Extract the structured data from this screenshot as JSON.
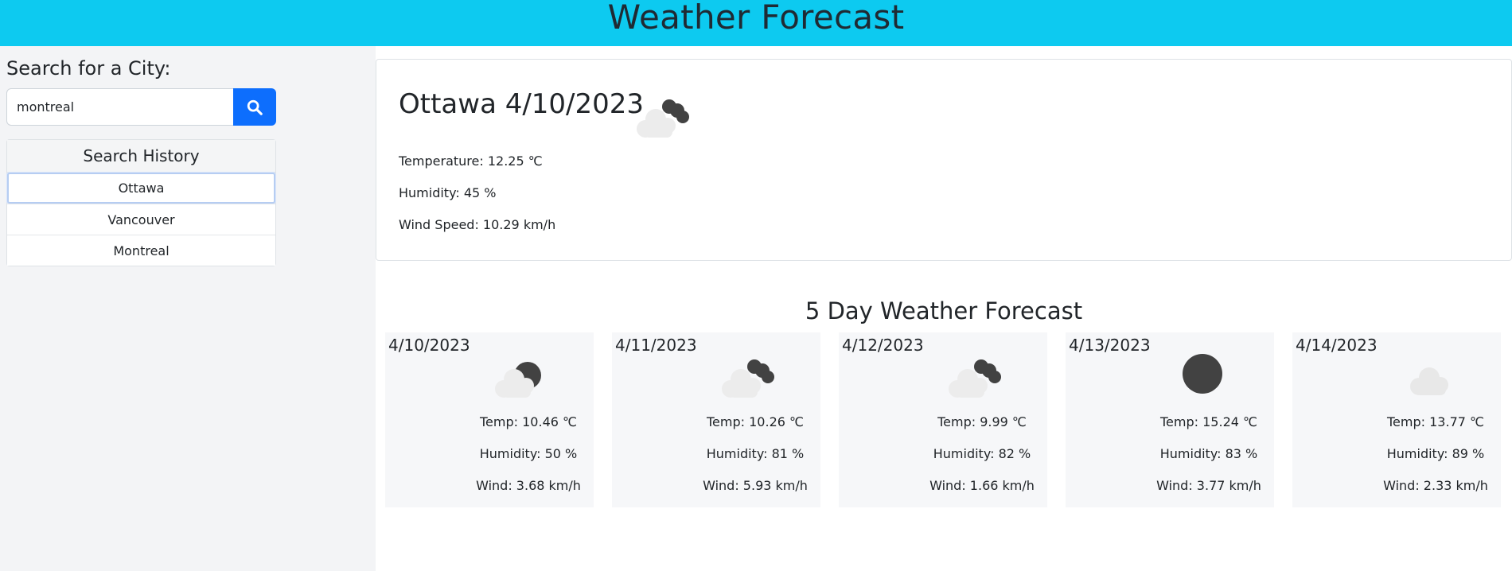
{
  "header": {
    "title": "Weather Forecast"
  },
  "search": {
    "label": "Search for a City:",
    "value": "montreal",
    "button_icon": "search-icon",
    "accent": "#0d6efd"
  },
  "history": {
    "title": "Search History",
    "items": [
      "Ottawa",
      "Vancouver",
      "Montreal"
    ]
  },
  "current": {
    "title": "Ottawa 4/10/2023",
    "icon": "broken-clouds-icon",
    "temperature": "Temperature: 12.25 ℃",
    "humidity": "Humidity: 45 %",
    "wind": "Wind Speed: 10.29 km/h"
  },
  "forecast": {
    "title": "5 Day Weather Forecast",
    "days": [
      {
        "date": "4/10/2023",
        "icon": "partly-cloudy-icon",
        "temp": "Temp: 10.46 ℃",
        "humidity": "Humidity: 50 %",
        "wind": "Wind: 3.68 km/h"
      },
      {
        "date": "4/11/2023",
        "icon": "broken-clouds-icon",
        "temp": "Temp: 10.26 ℃",
        "humidity": "Humidity: 81 %",
        "wind": "Wind: 5.93 km/h"
      },
      {
        "date": "4/12/2023",
        "icon": "broken-clouds-icon",
        "temp": "Temp: 9.99 ℃",
        "humidity": "Humidity: 82 %",
        "wind": "Wind: 1.66 km/h"
      },
      {
        "date": "4/13/2023",
        "icon": "clear-sky-icon",
        "temp": "Temp: 15.24 ℃",
        "humidity": "Humidity: 83 %",
        "wind": "Wind: 3.77 km/h"
      },
      {
        "date": "4/14/2023",
        "icon": "overcast-clouds-icon",
        "temp": "Temp: 13.77 ℃",
        "humidity": "Humidity: 89 %",
        "wind": "Wind: 2.33 km/h"
      }
    ]
  },
  "colors": {
    "header_bg": "#0dcaf0",
    "sidebar_bg": "#f3f4f6",
    "card_bg": "#f6f7f9",
    "icon_dark": "#424242",
    "icon_light": "#ececec"
  }
}
